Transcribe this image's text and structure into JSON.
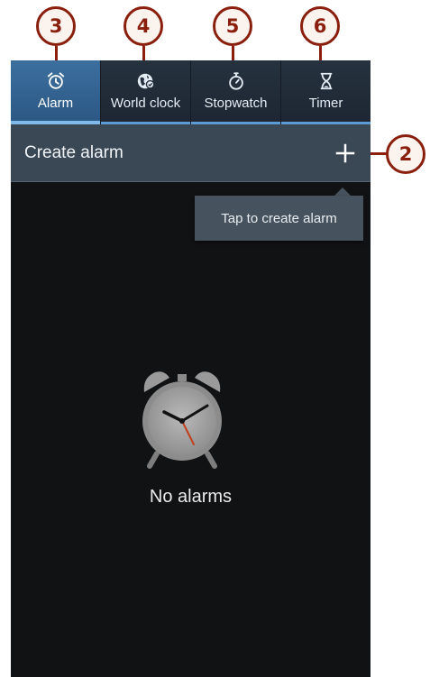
{
  "callouts": {
    "alarm_tab": "3",
    "world_clock_tab": "4",
    "stopwatch_tab": "5",
    "timer_tab": "6",
    "create_button": "2"
  },
  "tabs": [
    {
      "label": "Alarm",
      "icon": "alarm-clock-icon",
      "active": true
    },
    {
      "label": "World clock",
      "icon": "globe-icon",
      "active": false
    },
    {
      "label": "Stopwatch",
      "icon": "stopwatch-icon",
      "active": false
    },
    {
      "label": "Timer",
      "icon": "hourglass-icon",
      "active": false
    }
  ],
  "create_bar": {
    "label": "Create alarm",
    "button_icon": "plus-icon"
  },
  "tooltip": {
    "text": "Tap to create alarm"
  },
  "empty_state": {
    "icon": "alarm-clock-icon",
    "text": "No alarms"
  },
  "colors": {
    "callout": "#8a1f0e",
    "active_tab": "#3c6f9e",
    "background": "#111214",
    "create_bar": "#3a4754"
  }
}
